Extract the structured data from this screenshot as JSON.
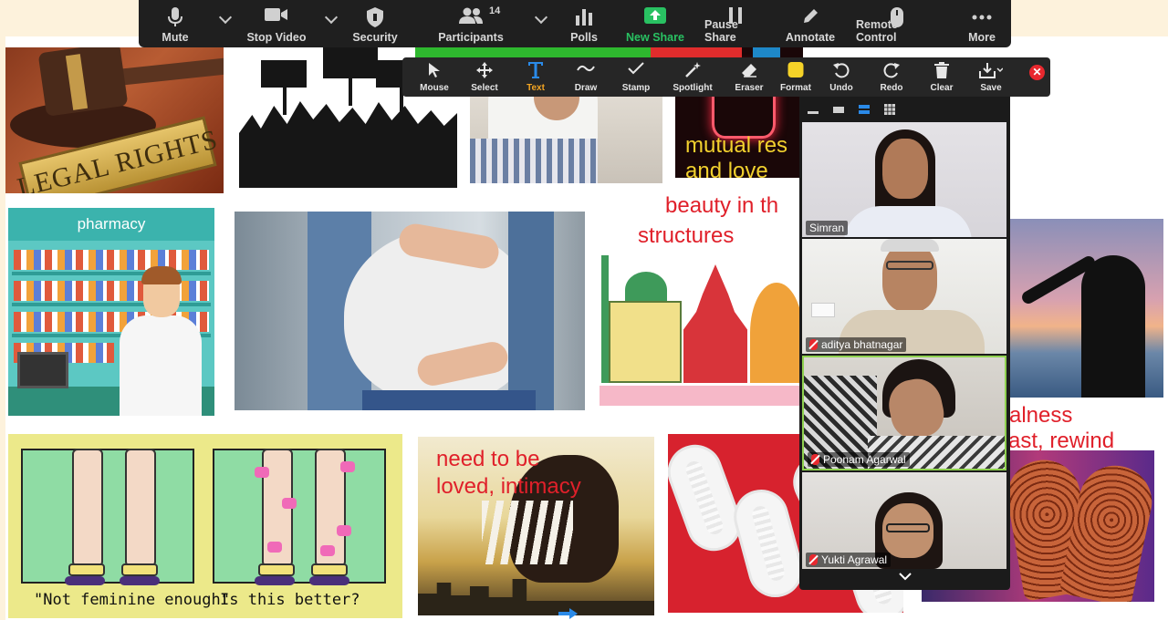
{
  "meeting_toolbar": {
    "mute": "Mute",
    "stop_video": "Stop Video",
    "security": "Security",
    "participants": "Participants",
    "participants_count": "14",
    "polls": "Polls",
    "new_share": "New Share",
    "pause_share": "Pause Share",
    "annotate": "Annotate",
    "remote_control": "Remote Control",
    "more": "More"
  },
  "annotation_toolbar": {
    "mouse": "Mouse",
    "select": "Select",
    "text": "Text",
    "draw": "Draw",
    "stamp": "Stamp",
    "spotlight": "Spotlight",
    "eraser": "Eraser",
    "format": "Format",
    "undo": "Undo",
    "redo": "Redo",
    "clear": "Clear",
    "save": "Save",
    "active_tool": "Text",
    "format_color": "#f5d328"
  },
  "shared_board": {
    "legal_rights_text": "LEGAL RIGHTS",
    "pharmacy_text": "pharmacy",
    "legs_caption_left": "\"Not feminine enough\"",
    "legs_caption_right": "Is this better?",
    "annotations": {
      "mutual_respect": "mutual res",
      "and_love": "and love",
      "beauty_line1": "beauty in th",
      "beauty_line2": "structures",
      "need_line1": "need to be",
      "need_line2": "loved, intimacy",
      "alness": "alness",
      "rewind": "ast, rewind"
    }
  },
  "video_panel": {
    "participants": [
      {
        "name": "Simran",
        "muted": false
      },
      {
        "name": "aditya bhatnagar",
        "muted": true
      },
      {
        "name": "Poonam Agarwal",
        "muted": true,
        "active_speaker": true
      },
      {
        "name": "Yukti Agrawal",
        "muted": true
      }
    ]
  },
  "colors": {
    "accent_green": "#29c162",
    "annotation_red": "#e0202a",
    "annotation_yellow": "#f2d12e",
    "close_red": "#e8282e"
  }
}
